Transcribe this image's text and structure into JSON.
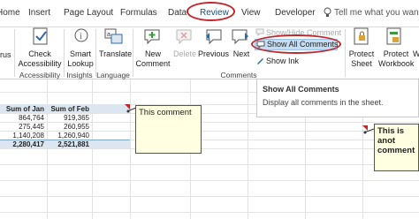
{
  "tabs": [
    "Home",
    "Insert",
    "Page Layout",
    "Formulas",
    "Data",
    "Review",
    "View",
    "Developer"
  ],
  "tell_me": "Tell me what you want to",
  "ribbon": {
    "left_partial": "rus",
    "check_accessibility": [
      "Check",
      "Accessibility"
    ],
    "smart_lookup": [
      "Smart",
      "Lookup"
    ],
    "translate": "Translate",
    "new_comment": [
      "New",
      "Comment"
    ],
    "delete": "Delete",
    "previous": "Previous",
    "next": "Next",
    "show_hide_comment": "Show/Hide Comment",
    "show_all_comments": "Show All Comments",
    "show_ink": "Show Ink",
    "protect_sheet": [
      "Protect",
      "Sheet"
    ],
    "protect_workbook": [
      "Protect",
      "Workbook"
    ],
    "partial_w": "W",
    "groups": {
      "accessibility": "Accessibility",
      "insights": "Insights",
      "language": "Language",
      "comments": "Comments"
    }
  },
  "tooltip": {
    "title": "Show All Comments",
    "desc": "Display all comments in the sheet."
  },
  "sheet": {
    "headers": [
      "Sum of Jan",
      "Sum of Feb"
    ],
    "rows": [
      [
        "864,764",
        "919,365"
      ],
      [
        "275,445",
        "260,955"
      ],
      [
        "1,140,208",
        "1,260,940"
      ],
      [
        "2,280,417",
        "2,521,881"
      ]
    ],
    "comment1": "This comment",
    "comment2": [
      "This is anot",
      "comment"
    ]
  },
  "colors": {
    "review_circle": "#c0272d",
    "comment_fill": "#ffffe1",
    "header_fill": "#dce6f1",
    "total_fill": "#dce6f1",
    "ribbon_icon": "#2e6aa8"
  }
}
